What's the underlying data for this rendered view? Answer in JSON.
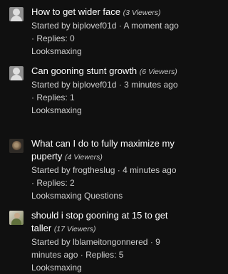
{
  "threads": [
    {
      "avatar_icon": "default-user-avatar-icon",
      "title": "How to get wider face",
      "viewers": "(3 Viewers)",
      "started_prefix": "Started by",
      "author": "biplovef01d",
      "time": "A moment ago",
      "replies": "Replies: 0",
      "forum": "Looksmaxing"
    },
    {
      "avatar_icon": "default-user-avatar-icon",
      "title": "Can gooning stunt growth",
      "viewers": "(6 Viewers)",
      "started_prefix": "Started by",
      "author": "biplovef01d",
      "time": "3 minutes ago",
      "replies": "Replies: 1",
      "forum": "Looksmaxing"
    },
    {
      "avatar_icon": "cat-avatar-icon",
      "title": "What can I do to fully maximize my puperty",
      "viewers": "(4 Viewers)",
      "started_prefix": "Started by",
      "author": "frogtheslug",
      "time": "4 minutes ago",
      "replies": "Replies: 2",
      "forum": "Looksmaxing Questions"
    },
    {
      "avatar_icon": "photo-avatar-icon",
      "title": "should i stop gooning at 15 to get taller",
      "viewers": "(17 Viewers)",
      "started_prefix": "Started by",
      "author": "lblameitongonnered",
      "time": "9 minutes ago",
      "replies": "Replies: 5",
      "forum": "Looksmaxing"
    }
  ]
}
